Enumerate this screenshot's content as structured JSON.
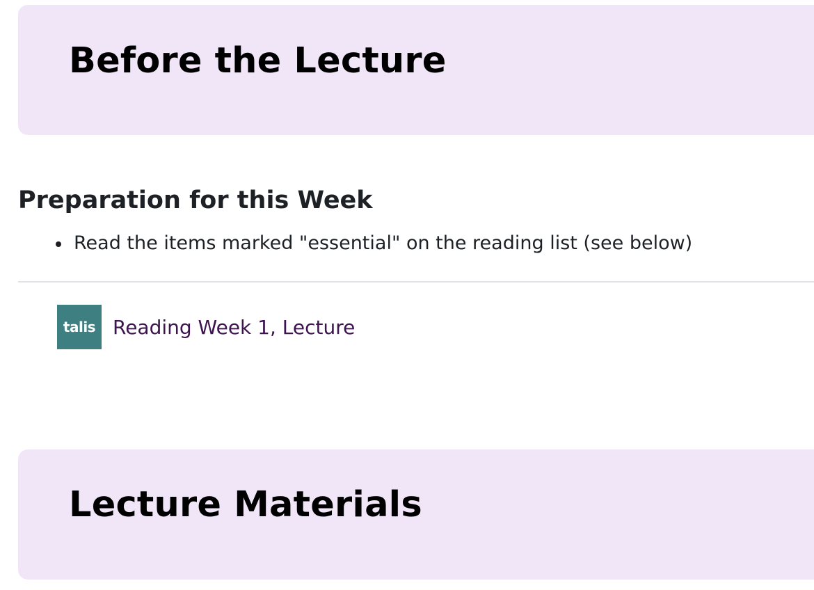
{
  "sections": {
    "before": {
      "title": "Before the Lecture"
    },
    "materials": {
      "title": "Lecture Materials"
    }
  },
  "preparation": {
    "heading": "Preparation for this Week",
    "items": [
      "Read the items marked \"essential\" on the reading list (see below)"
    ]
  },
  "activity": {
    "icon_text": "talis",
    "icon_name": "talis-icon",
    "link_text": "Reading Week 1, Lecture"
  },
  "colors": {
    "section_background": "#f1e6f7",
    "link": "#3d1450",
    "talis_brand": "#3e7f81"
  }
}
